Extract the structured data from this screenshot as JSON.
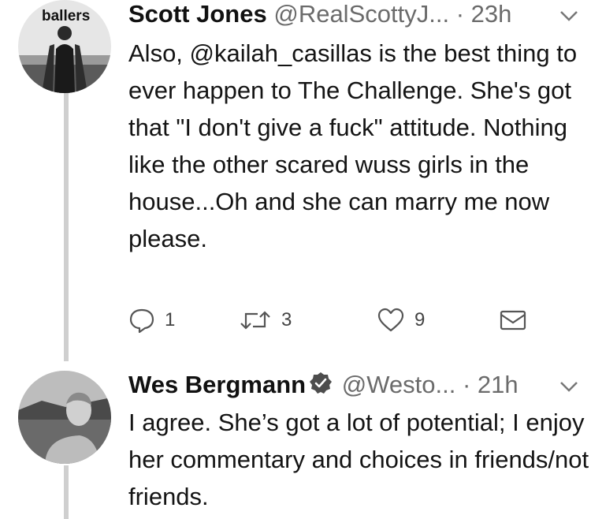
{
  "tweets": [
    {
      "avatar_text": "ballers",
      "name": "Scott Jones",
      "handle": "@RealScottyJ...",
      "separator": "·",
      "time": "23h",
      "body_pre": "Also, ",
      "mention": "@kailah_casillas",
      "body_post": " is the best thing to ever happen to The Challenge. She's got that \"I don't give a fuck\" attitude. Nothing like the other scared wuss girls in the house...Oh and she can marry me now please.",
      "actions": {
        "reply_count": "1",
        "retweet_count": "3",
        "like_count": "9"
      }
    },
    {
      "name": "Wes Bergmann",
      "verified": true,
      "handle": "@Westo...",
      "separator": "·",
      "time": "21h",
      "body": "I agree. She’s got a lot of potential; I enjoy her commentary and choices in friends/not friends."
    }
  ],
  "icons": {
    "reply": "reply-icon",
    "retweet": "retweet-icon",
    "like": "heart-icon",
    "dm": "envelope-icon",
    "more": "chevron-down-icon",
    "verified": "verified-badge-icon"
  }
}
